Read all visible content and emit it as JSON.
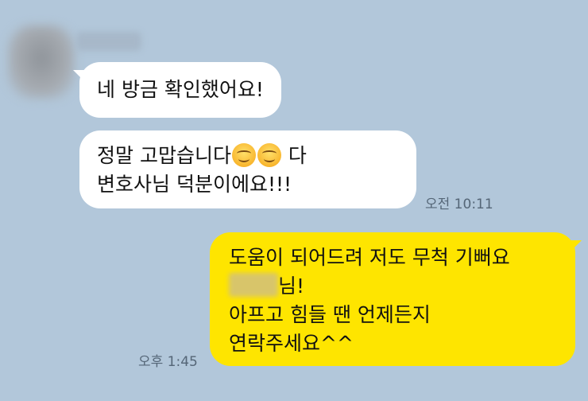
{
  "messages": [
    {
      "sender": "other",
      "lines": [
        "네 방금 확인했어요!"
      ]
    },
    {
      "sender": "other",
      "line1_a": "정말 고맙습니다",
      "line1_b": " 다",
      "line2": "변호사님 덕분이에요!!!",
      "time": "오전 10:11"
    },
    {
      "sender": "me",
      "line1": "도움이 되어드려 저도 무척 기뻐요",
      "line2_suffix": "님!",
      "line3": "아프고 힘들 땐 언제든지",
      "line4": "연락주세요^^",
      "time": "오후 1:45"
    }
  ],
  "colors": {
    "background": "#b2c7da",
    "incoming": "#ffffff",
    "outgoing": "#fee500"
  },
  "icons": [
    "smiling-emoji-icon",
    "smiling-emoji-icon"
  ]
}
